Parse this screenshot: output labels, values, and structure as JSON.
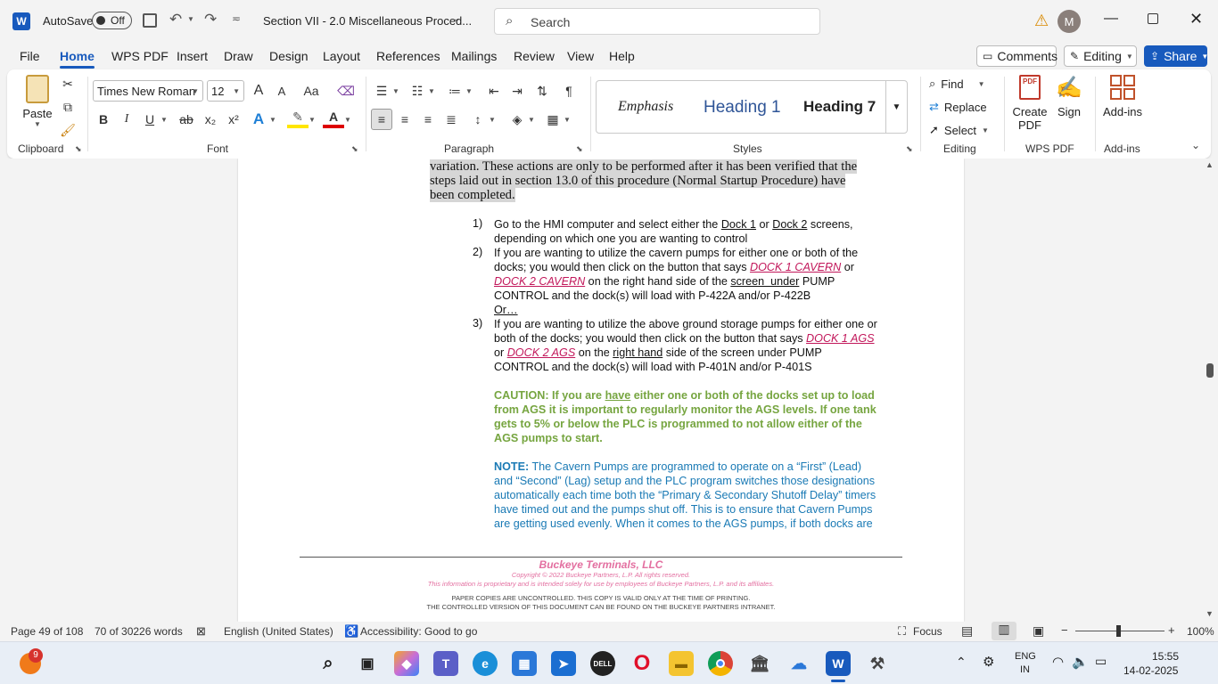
{
  "titlebar": {
    "autosave_label": "AutoSave",
    "autosave_state": "Off",
    "doc_title": "Section VII - 2.0 Miscellaneous Proced...",
    "search_placeholder": "Search",
    "avatar_initial": "M"
  },
  "menu": {
    "tabs": [
      "File",
      "Home",
      "WPS PDF",
      "Insert",
      "Draw",
      "Design",
      "Layout",
      "References",
      "Mailings",
      "Review",
      "View",
      "Help"
    ],
    "active": "Home",
    "comments": "Comments",
    "editing": "Editing",
    "share": "Share"
  },
  "ribbon": {
    "clipboard": {
      "paste": "Paste",
      "label": "Clipboard"
    },
    "font": {
      "name": "Times New Roman",
      "size": "12",
      "label": "Font",
      "grow": "A",
      "shrink": "A",
      "case": "Aa"
    },
    "paragraph": {
      "label": "Paragraph"
    },
    "styles": {
      "items": [
        "Emphasis",
        "Heading 1",
        "Heading 7"
      ],
      "label": "Styles"
    },
    "editing": {
      "find": "Find",
      "replace": "Replace",
      "select": "Select",
      "label": "Editing"
    },
    "wps": {
      "create": "Create",
      "pdf": "PDF",
      "sign": "Sign",
      "label": "WPS PDF"
    },
    "addins": {
      "button": "Add-ins",
      "label": "Add-ins"
    }
  },
  "doc": {
    "intro_lines": [
      "variation. These actions are only to be performed after it has been verified that the",
      "steps laid out in section 13.0 of this procedure (Normal Startup Procedure) have",
      "been completed."
    ],
    "item1": {
      "num": "1)",
      "a": "Go to the HMI computer and select either the ",
      "dock1": "Dock 1",
      "or": " or ",
      "dock2": "Dock 2",
      "b": " screens,",
      "c": "depending on which one you are wanting to control"
    },
    "item2": {
      "num": "2)",
      "l1": "If you are wanting to utilize the cavern pumps for either one or both of the",
      "l2a": "docks; you would then click on the button that says ",
      "link1": "DOCK 1 CAVERN",
      "l2b": " or",
      "link2": "DOCK 2 CAVERN",
      "l3a": " on the right hand side of the ",
      "screenunder": "screen  under",
      "l3b": " PUMP",
      "l4": "CONTROL and the dock(s) will load with P-422A and/or P-422B",
      "or": "Or…"
    },
    "item3": {
      "num": "3)",
      "l1": "If you are wanting to utilize the above ground storage pumps for either one or",
      "l2a": "both of the docks; you would then click on the button that says ",
      "link1": "DOCK 1 AGS",
      "l3a": "or ",
      "link2": "DOCK 2 AGS",
      "l3b": " on the ",
      "righthand": "right hand",
      "l3c": " side of the screen under PUMP",
      "l4": "CONTROL and the dock(s) will load with P-401N and/or P-401S"
    },
    "caution": {
      "l1a": "CAUTION: If you are ",
      "have": "have",
      "l1b": " either one or both of the docks set up to load",
      "l2": "from AGS it is important to regularly monitor the AGS levels. If one tank",
      "l3": "gets to 5% or below the PLC is programmed to not allow either of the",
      "l4": "AGS pumps to start."
    },
    "note": {
      "l1a": "NOTE:",
      "l1b": " The Cavern Pumps are programmed to operate on a “First” (Lead)",
      "l2": "and “Second” (Lag) setup and the PLC program switches those designations",
      "l3": "automatically each time both the “Primary & Secondary Shutoff Delay” timers",
      "l4": "have timed out and the pumps shut off. This is to ensure that Cavern Pumps",
      "l5": "are getting used evenly. When it comes to the AGS pumps, if both docks are"
    },
    "footer": {
      "company": "Buckeye Terminals, LLC",
      "copyright": "Copyright © 2022 Buckeye Partners, L.P. All rights reserved.",
      "proprietary": "This information is proprietary and is intended solely for use by employees of Buckeye Partners, L.P. and its affiliates.",
      "paper1": "PAPER COPIES ARE UNCONTROLLED. THIS COPY IS VALID ONLY AT THE TIME OF PRINTING.",
      "paper2": "THE CONTROLLED VERSION OF THIS DOCUMENT CAN BE FOUND ON THE BUCKEYE PARTNERS INTRANET."
    }
  },
  "status": {
    "page": "Page 49 of 108",
    "words": "70 of 30226 words",
    "language": "English (United States)",
    "accessibility": "Accessibility: Good to go",
    "focus": "Focus",
    "zoom": "100%"
  },
  "taskbar": {
    "badge": "9",
    "lang1": "ENG",
    "lang2": "IN",
    "time": "15:55",
    "date": "14-02-2025"
  },
  "colors": {
    "accent": "#185abd",
    "link": "#c2185b",
    "caution": "#76a540",
    "note": "#1a7ab5"
  }
}
